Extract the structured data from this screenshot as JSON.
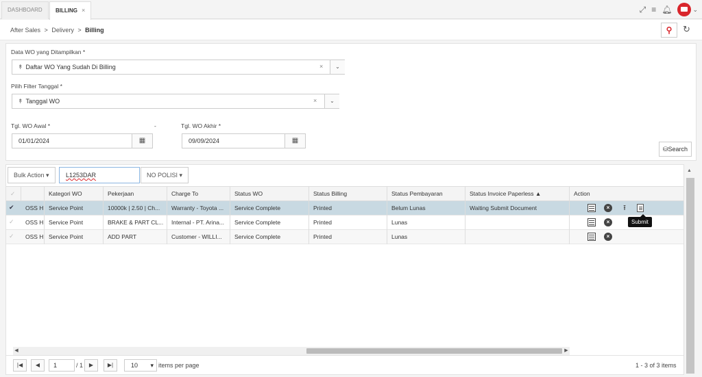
{
  "tabs": [
    {
      "label": "DASHBOARD"
    },
    {
      "label": "BILLING",
      "close": "×"
    }
  ],
  "breadcrumb": {
    "a": "After Sales",
    "b": "Delivery",
    "c": "Billing",
    "sep": ">"
  },
  "filters": {
    "wo_label": "Data WO yang Ditampilkan *",
    "wo_value": "Daftar WO Yang Sudah Di Billing",
    "tgl_label": "Pilih Filter Tanggal *",
    "tgl_value": "Tanggal WO",
    "awal_label": "Tgl. WO Awal *",
    "awal_value": "01/01/2024",
    "dash": "-",
    "akhir_label": "Tgl. WO Akhir *",
    "akhir_value": "09/09/2024",
    "search_label": "Search"
  },
  "toolbar": {
    "bulk_label": "Bulk Action ▾",
    "nopol_value": "L1253DAR",
    "nopol_dropdown": "NO POLISI ▾"
  },
  "columns": [
    "",
    "",
    "Kategori WO",
    "Pekerjaan",
    "Charge To",
    "Status WO",
    "Status Billing",
    "Status Pembayaran",
    "Status Invoice Paperless ▲",
    "Action"
  ],
  "rows": [
    {
      "c1": "OSS H...",
      "kategori": "Service Point",
      "pekerjaan": "10000k | 2.50 | Ch...",
      "charge": "Warranty - Toyota ...",
      "status_wo": "Service Complete",
      "billing": "Printed",
      "bayar": "Belum Lunas",
      "invoice": "Waiting Submit Document"
    },
    {
      "c1": "OSS H...",
      "kategori": "Service Point",
      "pekerjaan": "BRAKE & PART CL...",
      "charge": "Internal - PT. Arina...",
      "status_wo": "Service Complete",
      "billing": "Printed",
      "bayar": "Lunas",
      "invoice": ""
    },
    {
      "c1": "OSS H...",
      "kategori": "Service Point",
      "pekerjaan": "ADD PART",
      "charge": "Customer - WILLI...",
      "status_wo": "Service Complete",
      "billing": "Printed",
      "bayar": "Lunas",
      "invoice": ""
    }
  ],
  "tooltip": "Submit",
  "pager": {
    "page": "1",
    "of": "/ 1",
    "per_page": "10",
    "per_page_label": "items per page",
    "summary": "1 - 3 of 3 items"
  },
  "colors": {
    "accent": "#d9262c",
    "selected_row": "#c8d9e2"
  }
}
